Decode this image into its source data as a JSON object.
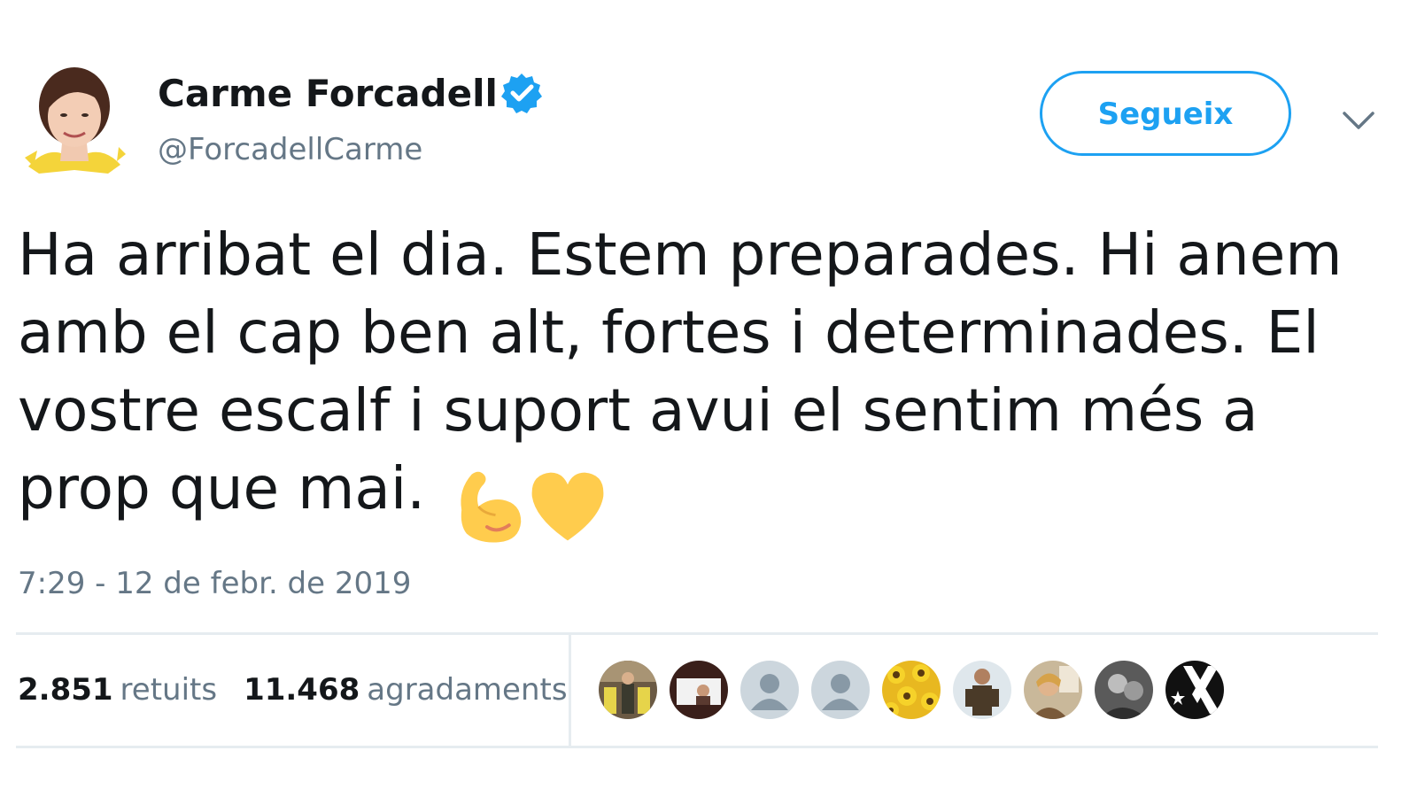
{
  "author": {
    "display_name": "Carme Forcadell",
    "handle": "@ForcadellCarme",
    "verified": true,
    "avatar_icon": "profile-photo"
  },
  "follow_button": {
    "label": "Segueix"
  },
  "menu": {
    "icon": "chevron-down-icon"
  },
  "tweet": {
    "text": "Ha arribat el dia. Estem preparades. Hi anem amb el cap ben alt, fortes i determinades. El vostre escalf i suport avui el sentim més a prop que mai.",
    "emojis": [
      "flexed-biceps-icon",
      "yellow-heart-icon"
    ],
    "timestamp": "7:29 - 12 de febr. de 2019"
  },
  "stats": {
    "retweets_count": "2.851",
    "retweets_label": "retuits",
    "likes_count": "11.468",
    "likes_label": "agradaments"
  },
  "likers": [
    {
      "icon": "liker-avatar-photo-1"
    },
    {
      "icon": "liker-avatar-photo-2"
    },
    {
      "icon": "default-avatar-icon"
    },
    {
      "icon": "default-avatar-icon"
    },
    {
      "icon": "sunflowers-avatar"
    },
    {
      "icon": "liker-avatar-photo-3"
    },
    {
      "icon": "liker-avatar-photo-4"
    },
    {
      "icon": "liker-avatar-photo-5"
    },
    {
      "icon": "star-x-logo-avatar"
    }
  ],
  "colors": {
    "brand_blue": "#1da1f2",
    "muted_text": "#657786",
    "main_text": "#14171a",
    "divider": "#e6ecf0",
    "emoji_yellow": "#ffcc4d"
  }
}
